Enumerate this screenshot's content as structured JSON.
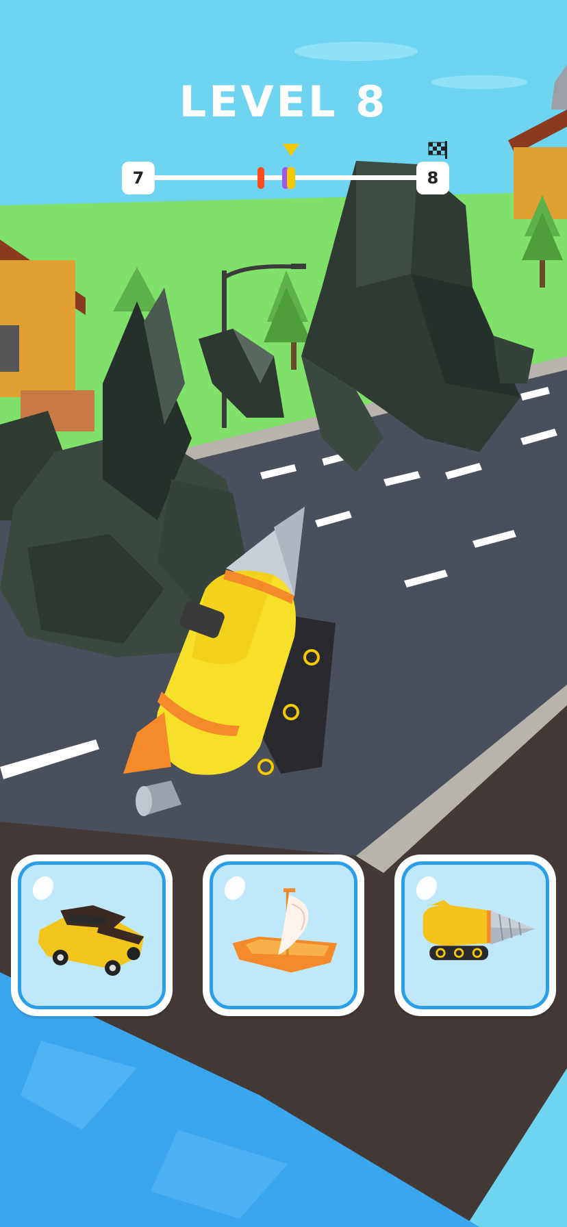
{
  "hud": {
    "level_title": "LEVEL 8",
    "current_level": "7",
    "next_level": "8",
    "player_progress": 0.52,
    "opponent_markers": [
      {
        "color": "#ff4a1c",
        "progress": 0.41
      },
      {
        "color": "#9b59f0",
        "progress": 0.5
      }
    ],
    "player_color": "#f6c800"
  },
  "vehicle_options": [
    {
      "name": "car-icon"
    },
    {
      "name": "boat-icon"
    },
    {
      "name": "drill-icon"
    }
  ],
  "colors": {
    "sky": "#6fd4f0",
    "grass": "#7fe06a",
    "road": "#4a4f5c",
    "water": "#3aa6ee",
    "card_border": "#2a9fe8",
    "card_fill": "#bfe8fb",
    "drill_yellow": "#f7e02a"
  }
}
